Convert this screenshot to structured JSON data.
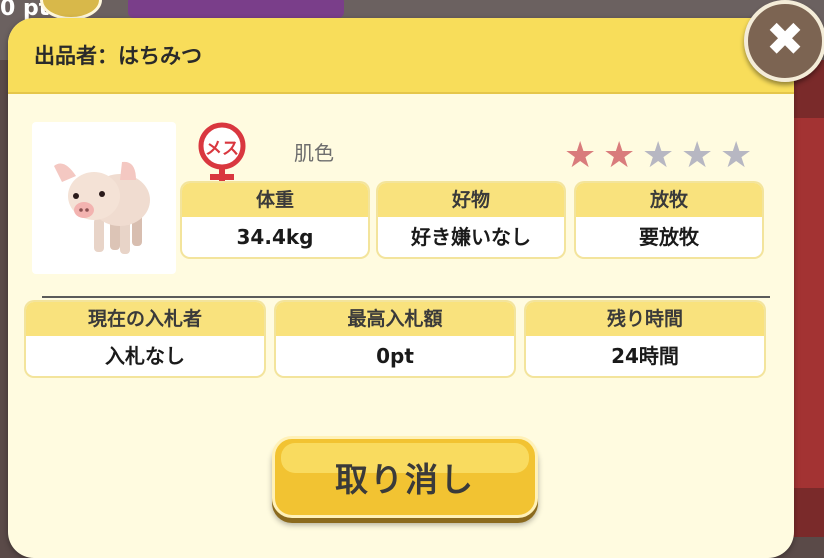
{
  "background": {
    "points_text": "0 pt"
  },
  "dialog": {
    "seller_label": "出品者：はちみつ",
    "gender_icon_text": "メス",
    "skin_color": "肌色",
    "rating": {
      "value": 2,
      "max": 5,
      "filled_color": "#d97c7c",
      "empty_color": "#b7b7c2"
    },
    "pig_stats": [
      {
        "label": "体重",
        "value": "34.4kg"
      },
      {
        "label": "好物",
        "value": "好き嫌いなし"
      },
      {
        "label": "放牧",
        "value": "要放牧"
      }
    ],
    "auction_stats": [
      {
        "label": "現在の入札者",
        "value": "入札なし"
      },
      {
        "label": "最高入札額",
        "value": "0pt"
      },
      {
        "label": "残り時間",
        "value": "24時間"
      }
    ],
    "cancel_button_label": "取り消し",
    "close_button_label": "✖",
    "colors": {
      "header": "#f8dd5a",
      "panel": "#fffbe0",
      "button": "#f2c332",
      "gender": "#d9373f"
    }
  }
}
